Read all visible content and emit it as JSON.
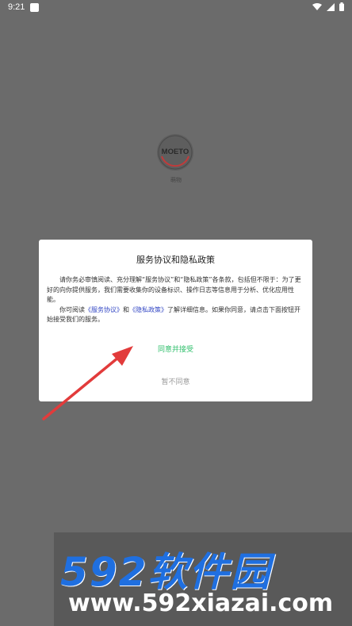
{
  "status_bar": {
    "time": "9:21",
    "icons": [
      "wifi-icon",
      "cell-signal-icon",
      "battery-icon"
    ]
  },
  "splash": {
    "logo_text": "MOETO",
    "caption": "萌物"
  },
  "dialog": {
    "title": "服务协议和隐私政策",
    "paragraph1": "请你务必审慎阅读、充分理解“服务协议”和“隐私政策”各条款，包括但不限于：为了更好的向你提供服务，我们需要收集你的设备标识、操作日志等信息用于分析、优化应用性能。",
    "p2_prefix": "你可阅读",
    "link_terms": "《服务协议》",
    "p2_and": "和",
    "link_privacy": "《隐私政策》",
    "p2_suffix": "了解详细信息。如果你同意，请点击下面按钮开始接受我们的服务。",
    "agree_label": "同意并接受",
    "disagree_label": "暂不同意"
  },
  "watermark": {
    "brand": "592软件园",
    "domain": "www.592xiazai.com"
  },
  "colors": {
    "overlay": "#6b6b6b",
    "agree": "#2fbf6b",
    "link": "#3347c4",
    "arrow": "#e23b3b",
    "brand_blue": "#1f6fe0"
  }
}
